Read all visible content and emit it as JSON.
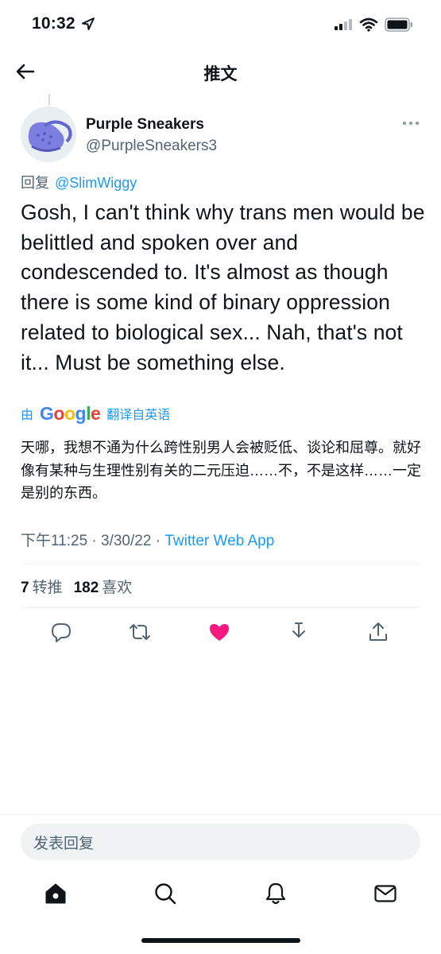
{
  "status_bar": {
    "time": "10:32"
  },
  "header": {
    "title": "推文"
  },
  "tweet": {
    "author_name": "Purple Sneakers",
    "author_handle": "@PurpleSneakers3",
    "reply_prefix": "回复",
    "reply_to": "@SlimWiggy",
    "text": "Gosh, I can't think why trans men would be belittled and spoken over and condescended to. It's almost as though there is some kind of binary oppression related to biological sex... Nah, that's not it... Must be something else.",
    "translate_prefix": "由",
    "translate_suffix": "翻译自英语",
    "translation": "天哪，我想不通为什么跨性别男人会被贬低、谈论和屈尊。就好像有某种与生理性别有关的二元压迫……不，不是这样……一定是别的东西。",
    "timestamp": "下午11:25 · 3/30/22 · ",
    "source_app": "Twitter Web App",
    "retweets": "7",
    "retweets_label": "转推",
    "likes": "182",
    "likes_label": "喜欢"
  },
  "colors": {
    "accent": "#1d9bf0",
    "like": "#f91880",
    "secondary_text": "#536471"
  },
  "icons": {
    "actions": [
      "reply-icon",
      "retweet-icon",
      "like-icon-filled",
      "bookmark-icon",
      "share-icon"
    ],
    "tabs": [
      "home-icon",
      "search-icon",
      "notifications-icon",
      "messages-icon"
    ]
  },
  "reply_box": {
    "placeholder": "发表回复"
  }
}
